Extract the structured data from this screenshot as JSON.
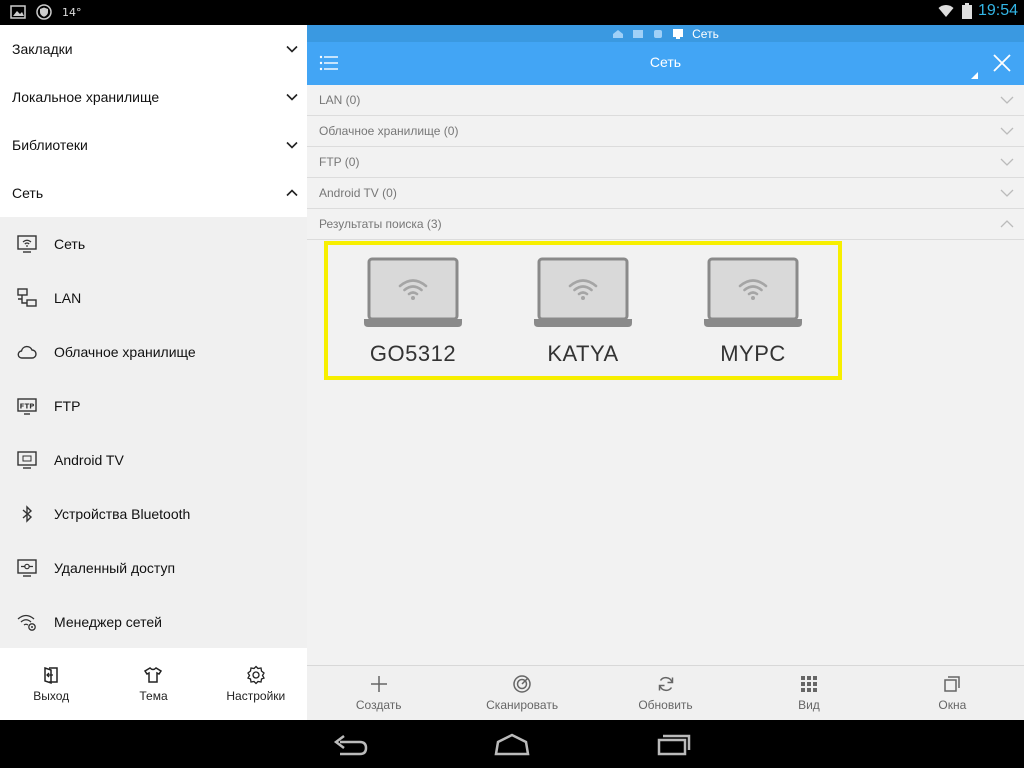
{
  "status": {
    "temperature": "14°",
    "time": "19:54",
    "icons": [
      "image-icon",
      "shield-icon",
      "wifi-icon",
      "battery-icon"
    ]
  },
  "sidebar": {
    "sections": [
      {
        "label": "Закладки",
        "expanded": false
      },
      {
        "label": "Локальное хранилище",
        "expanded": false
      },
      {
        "label": "Библиотеки",
        "expanded": false
      },
      {
        "label": "Сеть",
        "expanded": true
      }
    ],
    "items": [
      {
        "label": "Сеть",
        "icon": "network-icon"
      },
      {
        "label": "LAN",
        "icon": "lan-icon"
      },
      {
        "label": "Облачное хранилище",
        "icon": "cloud-icon"
      },
      {
        "label": "FTP",
        "icon": "ftp-icon"
      },
      {
        "label": "Android TV",
        "icon": "tv-icon"
      },
      {
        "label": "Устройства Bluetooth",
        "icon": "bluetooth-icon"
      },
      {
        "label": "Удаленный доступ",
        "icon": "remote-access-icon"
      },
      {
        "label": "Менеджер сетей",
        "icon": "network-manager-icon"
      }
    ],
    "bottom": [
      {
        "label": "Выход",
        "icon": "exit-icon"
      },
      {
        "label": "Тема",
        "icon": "shirt-icon"
      },
      {
        "label": "Настройки",
        "icon": "gear-icon"
      }
    ]
  },
  "breadcrumb": {
    "current": "Сеть"
  },
  "toolbar": {
    "title": "Сеть"
  },
  "groups": [
    {
      "label": "LAN (0)",
      "expanded": false
    },
    {
      "label": "Облачное хранилище (0)",
      "expanded": false
    },
    {
      "label": "FTP (0)",
      "expanded": false
    },
    {
      "label": "Android TV (0)",
      "expanded": false
    },
    {
      "label": "Результаты поиска (3)",
      "expanded": true
    }
  ],
  "devices": [
    {
      "name": "GO5312",
      "icon": "laptop-wifi-icon"
    },
    {
      "name": "KATYA",
      "icon": "laptop-wifi-icon"
    },
    {
      "name": "MYPC",
      "icon": "laptop-wifi-icon"
    }
  ],
  "actions": [
    {
      "label": "Создать",
      "icon": "plus-icon"
    },
    {
      "label": "Сканировать",
      "icon": "scan-icon"
    },
    {
      "label": "Обновить",
      "icon": "refresh-icon"
    },
    {
      "label": "Вид",
      "icon": "grid-icon"
    },
    {
      "label": "Окна",
      "icon": "windows-icon"
    }
  ],
  "colors": {
    "accent": "#42a5f5",
    "highlight": "#f7ef00",
    "clock": "#33b5e5"
  }
}
